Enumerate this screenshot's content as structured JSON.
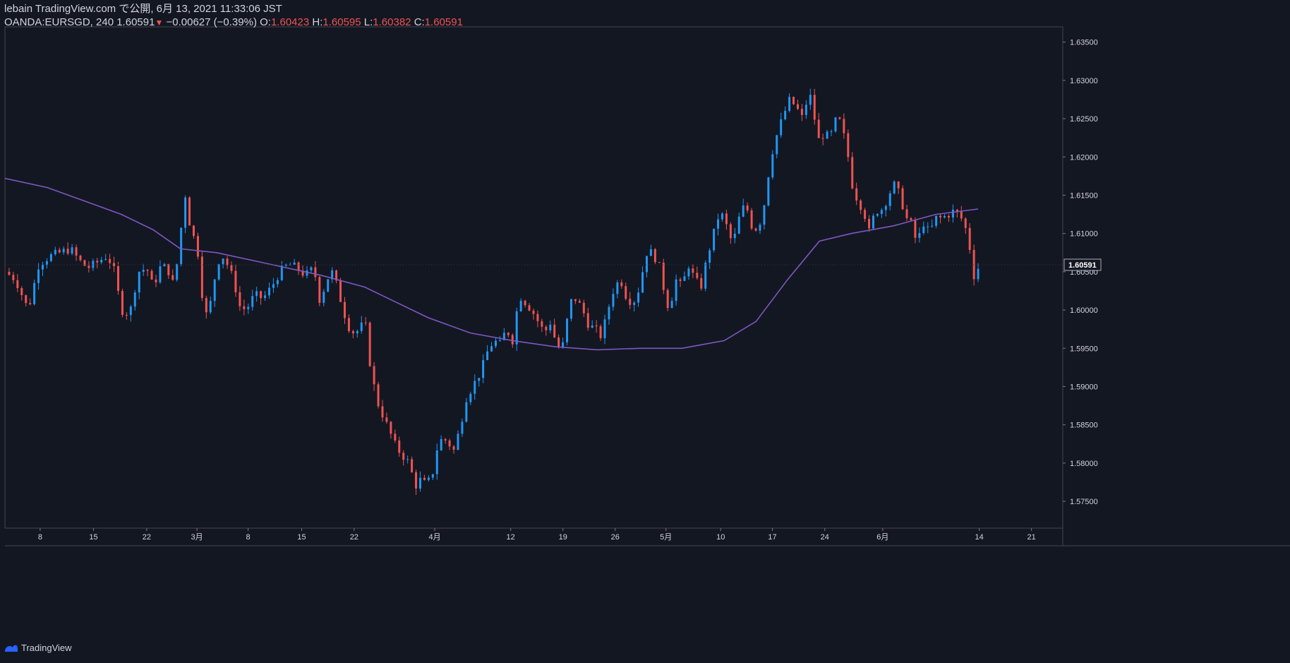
{
  "header": {
    "published": "lebain TradingView.com で公開, 6月 13, 2021 11:33:06 JST",
    "symbol": "OANDA:EURSGD, 240",
    "last": "1.60591",
    "arrow": "▼",
    "change": "−0.00627 (−0.39%)",
    "o_label": "O:",
    "o": "1.60423",
    "h_label": "H:",
    "h": "1.60595",
    "l_label": "L:",
    "l": "1.60382",
    "c_label": "C:",
    "c": "1.60591"
  },
  "footer": {
    "brand": "TradingView",
    "logo_icon": "tradingview-logo-icon"
  },
  "colors": {
    "bg": "#131722",
    "up": "#2962ff",
    "up_light": "#2196f3",
    "down": "#ef5350",
    "ma": "#7e57c2",
    "grid": "#2a2e39",
    "text": "#d1d4dc"
  },
  "chart_data": {
    "type": "candlestick",
    "ylim": [
      1.5715,
      1.637
    ],
    "y_ticks": [
      "1.63500",
      "1.63000",
      "1.62500",
      "1.62000",
      "1.61500",
      "1.61000",
      "1.60500",
      "1.60000",
      "1.59500",
      "1.59000",
      "1.58500",
      "1.58000",
      "1.57500"
    ],
    "last_price_label": "1.60591",
    "x_ticks": [
      {
        "label": "8",
        "x": 0.0333
      },
      {
        "label": "15",
        "x": 0.0837
      },
      {
        "label": "22",
        "x": 0.134
      },
      {
        "label": "3月",
        "x": 0.1815
      },
      {
        "label": "8",
        "x": 0.2299
      },
      {
        "label": "15",
        "x": 0.2805
      },
      {
        "label": "22",
        "x": 0.3301
      },
      {
        "label": "4月",
        "x": 0.4063
      },
      {
        "label": "12",
        "x": 0.4781
      },
      {
        "label": "19",
        "x": 0.5275
      },
      {
        "label": "26",
        "x": 0.5769
      },
      {
        "label": "5月",
        "x": 0.6249
      },
      {
        "label": "10",
        "x": 0.6766
      },
      {
        "label": "17",
        "x": 0.7255
      },
      {
        "label": "24",
        "x": 0.775
      },
      {
        "label": "6月",
        "x": 0.8298
      },
      {
        "label": "14",
        "x": 0.921
      },
      {
        "label": "21",
        "x": 0.9704
      }
    ],
    "price_path": [
      [
        0.0,
        1.605
      ],
      [
        0.01,
        1.604
      ],
      [
        0.022,
        1.6
      ],
      [
        0.032,
        1.606
      ],
      [
        0.042,
        1.607
      ],
      [
        0.052,
        1.6075
      ],
      [
        0.062,
        1.608
      ],
      [
        0.07,
        1.6065
      ],
      [
        0.078,
        1.6055
      ],
      [
        0.085,
        1.606
      ],
      [
        0.095,
        1.607
      ],
      [
        0.102,
        1.606
      ],
      [
        0.11,
        1.6
      ],
      [
        0.118,
        1.5995
      ],
      [
        0.126,
        1.605
      ],
      [
        0.134,
        1.6055
      ],
      [
        0.14,
        1.603
      ],
      [
        0.148,
        1.606
      ],
      [
        0.155,
        1.605
      ],
      [
        0.16,
        1.603
      ],
      [
        0.166,
        1.61
      ],
      [
        0.17,
        1.6155
      ],
      [
        0.175,
        1.611
      ],
      [
        0.182,
        1.608
      ],
      [
        0.188,
        1.6
      ],
      [
        0.192,
        1.599
      ],
      [
        0.198,
        1.604
      ],
      [
        0.204,
        1.6075
      ],
      [
        0.21,
        1.606
      ],
      [
        0.216,
        1.604
      ],
      [
        0.222,
        1.6005
      ],
      [
        0.228,
        1.6
      ],
      [
        0.236,
        1.602
      ],
      [
        0.244,
        1.6015
      ],
      [
        0.252,
        1.603
      ],
      [
        0.26,
        1.605
      ],
      [
        0.268,
        1.606
      ],
      [
        0.276,
        1.6055
      ],
      [
        0.284,
        1.6045
      ],
      [
        0.292,
        1.6055
      ],
      [
        0.298,
        1.601
      ],
      [
        0.304,
        1.604
      ],
      [
        0.31,
        1.605
      ],
      [
        0.318,
        1.601
      ],
      [
        0.324,
        1.598
      ],
      [
        0.33,
        1.597
      ],
      [
        0.336,
        1.5975
      ],
      [
        0.34,
        1.599
      ],
      [
        0.346,
        1.592
      ],
      [
        0.352,
        1.588
      ],
      [
        0.358,
        1.586
      ],
      [
        0.364,
        1.584
      ],
      [
        0.37,
        1.582
      ],
      [
        0.376,
        1.581
      ],
      [
        0.382,
        1.58
      ],
      [
        0.388,
        1.577
      ],
      [
        0.394,
        1.578
      ],
      [
        0.398,
        1.577
      ],
      [
        0.404,
        1.5785
      ],
      [
        0.41,
        1.583
      ],
      [
        0.418,
        1.583
      ],
      [
        0.424,
        1.5815
      ],
      [
        0.43,
        1.5845
      ],
      [
        0.436,
        1.5885
      ],
      [
        0.442,
        1.59
      ],
      [
        0.45,
        1.592
      ],
      [
        0.456,
        1.5945
      ],
      [
        0.462,
        1.596
      ],
      [
        0.468,
        1.5955
      ],
      [
        0.474,
        1.5975
      ],
      [
        0.48,
        1.596
      ],
      [
        0.486,
        1.602
      ],
      [
        0.492,
        1.601
      ],
      [
        0.498,
        1.6
      ],
      [
        0.504,
        1.5985
      ],
      [
        0.51,
        1.597
      ],
      [
        0.516,
        1.5985
      ],
      [
        0.522,
        1.595
      ],
      [
        0.528,
        1.5955
      ],
      [
        0.534,
        1.601
      ],
      [
        0.54,
        1.6015
      ],
      [
        0.546,
        1.6
      ],
      [
        0.552,
        1.598
      ],
      [
        0.558,
        1.5975
      ],
      [
        0.564,
        1.5965
      ],
      [
        0.57,
        1.6
      ],
      [
        0.576,
        1.603
      ],
      [
        0.582,
        1.604
      ],
      [
        0.588,
        1.6015
      ],
      [
        0.594,
        1.601
      ],
      [
        0.6,
        1.603
      ],
      [
        0.606,
        1.6075
      ],
      [
        0.612,
        1.6075
      ],
      [
        0.618,
        1.606
      ],
      [
        0.624,
        1.602
      ],
      [
        0.628,
        1.6
      ],
      [
        0.634,
        1.604
      ],
      [
        0.64,
        1.603
      ],
      [
        0.646,
        1.606
      ],
      [
        0.652,
        1.604
      ],
      [
        0.658,
        1.603
      ],
      [
        0.664,
        1.607
      ],
      [
        0.67,
        1.61
      ],
      [
        0.676,
        1.613
      ],
      [
        0.682,
        1.611
      ],
      [
        0.688,
        1.6085
      ],
      [
        0.694,
        1.612
      ],
      [
        0.7,
        1.614
      ],
      [
        0.706,
        1.611
      ],
      [
        0.712,
        1.6105
      ],
      [
        0.718,
        1.614
      ],
      [
        0.724,
        1.62
      ],
      [
        0.73,
        1.623
      ],
      [
        0.736,
        1.6255
      ],
      [
        0.742,
        1.6275
      ],
      [
        0.748,
        1.6265
      ],
      [
        0.754,
        1.625
      ],
      [
        0.76,
        1.6285
      ],
      [
        0.764,
        1.6265
      ],
      [
        0.768,
        1.622
      ],
      [
        0.774,
        1.623
      ],
      [
        0.78,
        1.6225
      ],
      [
        0.786,
        1.625
      ],
      [
        0.79,
        1.6245
      ],
      [
        0.796,
        1.621
      ],
      [
        0.802,
        1.6155
      ],
      [
        0.808,
        1.614
      ],
      [
        0.814,
        1.612
      ],
      [
        0.818,
        1.6095
      ],
      [
        0.822,
        1.613
      ],
      [
        0.828,
        1.613
      ],
      [
        0.834,
        1.6145
      ],
      [
        0.84,
        1.6165
      ],
      [
        0.846,
        1.615
      ],
      [
        0.852,
        1.612
      ],
      [
        0.858,
        1.611
      ],
      [
        0.862,
        1.6085
      ],
      [
        0.868,
        1.6115
      ],
      [
        0.874,
        1.61
      ],
      [
        0.88,
        1.612
      ],
      [
        0.886,
        1.612
      ],
      [
        0.892,
        1.6125
      ],
      [
        0.898,
        1.613
      ],
      [
        0.904,
        1.612
      ],
      [
        0.91,
        1.61
      ],
      [
        0.916,
        1.6045
      ],
      [
        0.92,
        1.6055
      ]
    ],
    "ma_path": [
      [
        0.0,
        1.6172
      ],
      [
        0.04,
        1.616
      ],
      [
        0.08,
        1.614
      ],
      [
        0.11,
        1.6125
      ],
      [
        0.14,
        1.6105
      ],
      [
        0.166,
        1.608
      ],
      [
        0.2,
        1.6075
      ],
      [
        0.25,
        1.606
      ],
      [
        0.3,
        1.6045
      ],
      [
        0.34,
        1.603
      ],
      [
        0.37,
        1.601
      ],
      [
        0.4,
        1.599
      ],
      [
        0.44,
        1.597
      ],
      [
        0.48,
        1.596
      ],
      [
        0.52,
        1.5952
      ],
      [
        0.56,
        1.5948
      ],
      [
        0.6,
        1.595
      ],
      [
        0.64,
        1.595
      ],
      [
        0.68,
        1.596
      ],
      [
        0.71,
        1.5985
      ],
      [
        0.74,
        1.604
      ],
      [
        0.77,
        1.609
      ],
      [
        0.8,
        1.61
      ],
      [
        0.84,
        1.611
      ],
      [
        0.88,
        1.6125
      ],
      [
        0.92,
        1.6132
      ]
    ]
  }
}
